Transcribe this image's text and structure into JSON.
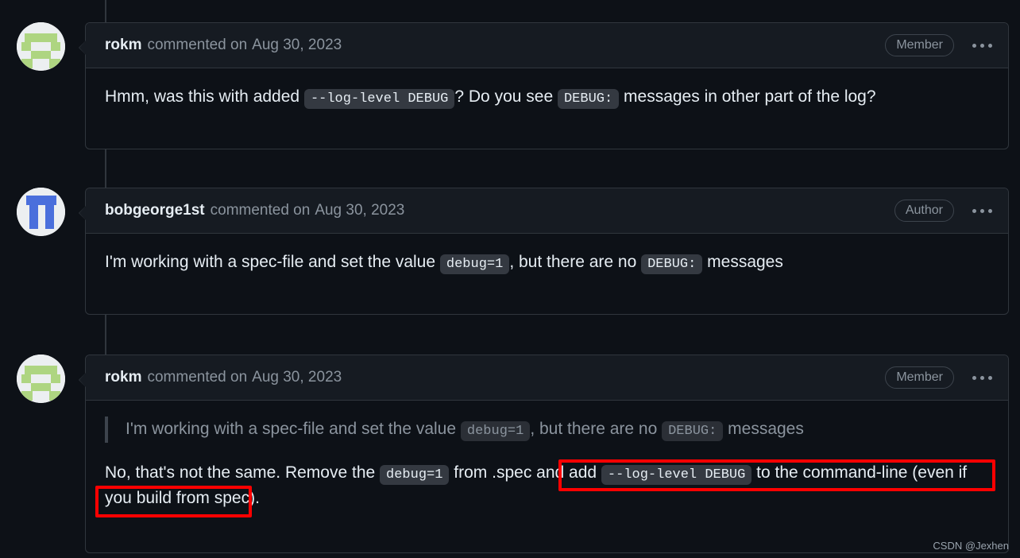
{
  "page": {
    "background_color": "#0d1117",
    "accent_highlight_color": "#ff0000",
    "watermark": "CSDN @Jexhen"
  },
  "comments": [
    {
      "id": "comment-1",
      "author": "rokm",
      "action": "commented on",
      "date": "Aug 30, 2023",
      "badge": "Member",
      "avatar": "identicon-green",
      "body_parts": [
        {
          "type": "text",
          "value": "Hmm, was this with added "
        },
        {
          "type": "code",
          "value": "--log-level DEBUG"
        },
        {
          "type": "text",
          "value": "? Do you see "
        },
        {
          "type": "code",
          "value": "DEBUG:"
        },
        {
          "type": "text",
          "value": " messages in other part of the log?"
        }
      ]
    },
    {
      "id": "comment-2",
      "author": "bobgeorge1st",
      "action": "commented on",
      "date": "Aug 30, 2023",
      "badge": "Author",
      "avatar": "avatar-blue-tt",
      "body_parts": [
        {
          "type": "text",
          "value": "I'm working with a spec-file and set the value "
        },
        {
          "type": "code",
          "value": "debug=1"
        },
        {
          "type": "text",
          "value": ", but there are no "
        },
        {
          "type": "code",
          "value": "DEBUG:"
        },
        {
          "type": "text",
          "value": " messages"
        }
      ]
    },
    {
      "id": "comment-3",
      "author": "rokm",
      "action": "commented on",
      "date": "Aug 30, 2023",
      "badge": "Member",
      "avatar": "identicon-green",
      "quote_parts": [
        {
          "type": "text",
          "value": "I'm working with a spec-file and set the value "
        },
        {
          "type": "code",
          "value": "debug=1"
        },
        {
          "type": "text",
          "value": ", but there are no "
        },
        {
          "type": "code",
          "value": "DEBUG:"
        },
        {
          "type": "text",
          "value": " messages"
        }
      ],
      "body_parts": [
        {
          "type": "text",
          "value": "No, that's not the same. Remove the "
        },
        {
          "type": "code",
          "value": "debug=1"
        },
        {
          "type": "text",
          "value": " from .spec and add "
        },
        {
          "type": "code",
          "value": "--log-level DEBUG"
        },
        {
          "type": "text",
          "value": " to the command-line (even if you build from spec)."
        }
      ]
    }
  ],
  "annotations": {
    "highlight_1_label": "add --log-level DEBUG to the command-line (even if you",
    "highlight_2_label": "build from spec)."
  },
  "icons": {
    "kebab": "kebab-menu-icon"
  }
}
